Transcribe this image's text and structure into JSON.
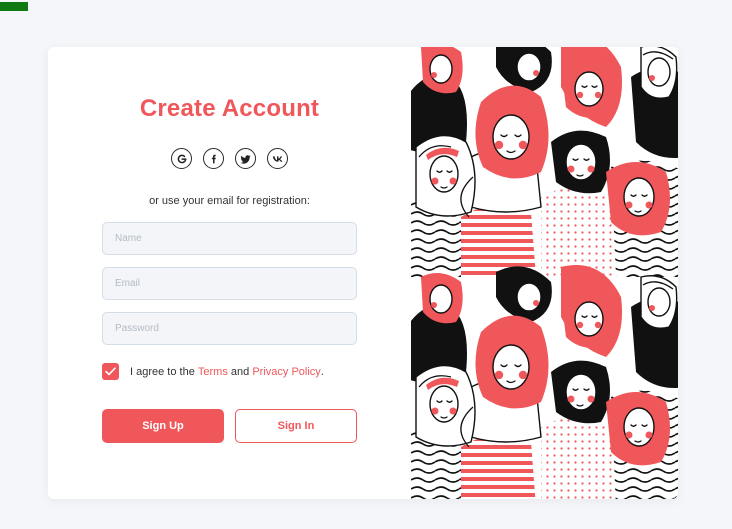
{
  "form": {
    "title": "Create Account",
    "social_buttons": [
      {
        "icon": "google-icon",
        "glyph": "G"
      },
      {
        "icon": "facebook-icon",
        "glyph": "f"
      },
      {
        "icon": "twitter-icon",
        "glyph": "twitter"
      },
      {
        "icon": "vk-icon",
        "glyph": "vk"
      }
    ],
    "subtitle": "or use your email for registration:",
    "name_field": {
      "placeholder": "Name",
      "value": ""
    },
    "email_field": {
      "placeholder": "Email",
      "value": ""
    },
    "password_field": {
      "placeholder": "Password",
      "value": ""
    },
    "agree": {
      "checked": true,
      "prefix": "I agree to the",
      "terms_link": "Terms",
      "conjunction": "and",
      "privacy_link": "Privacy Policy",
      "suffix": "."
    },
    "signup_label": "Sign Up",
    "signin_label": "Sign In"
  },
  "colors": {
    "accent": "#f0575a",
    "background": "#f4f6f9",
    "card": "#ffffff",
    "input_bg": "#f3f5f8",
    "input_border": "#d5dde6",
    "illustration_ink": "#111111"
  },
  "illustration": {
    "icon": "crowd-of-women-illustration"
  }
}
